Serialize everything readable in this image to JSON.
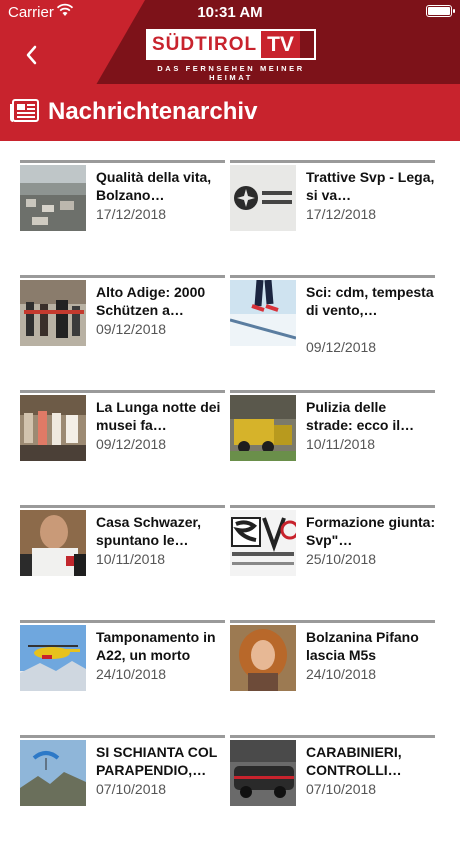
{
  "status_bar": {
    "carrier": "Carrier",
    "time": "10:31 AM"
  },
  "header": {
    "logo_left": "SÜDTIROL",
    "logo_right": "TV",
    "tagline": "DAS FERNSEHEN MEINER HEIMAT"
  },
  "section": {
    "title": "Nachrichtenarchiv"
  },
  "articles": [
    {
      "headline": "Qualità della vita, Bolzano…",
      "date": "17/12/2018"
    },
    {
      "headline": "Trattive Svp - Lega, si va…",
      "date": "17/12/2018"
    },
    {
      "headline": "Alto Adige: 2000 Schützen a…",
      "date": "09/12/2018"
    },
    {
      "headline": "Sci: cdm, tempesta di vento,…",
      "date": "09/12/2018"
    },
    {
      "headline": "La Lunga notte dei musei fa…",
      "date": "09/12/2018"
    },
    {
      "headline": "Pulizia delle strade: ecco il…",
      "date": "10/11/2018"
    },
    {
      "headline": "Casa Schwazer, spuntano le…",
      "date": "10/11/2018"
    },
    {
      "headline": "Formazione giunta: Svp\"…",
      "date": "25/10/2018"
    },
    {
      "headline": "Tamponamento in A22, un morto",
      "date": "24/10/2018"
    },
    {
      "headline": "Bolzanina Pifano lascia M5s",
      "date": "24/10/2018"
    },
    {
      "headline": "SI SCHIANTA COL PARAPENDIO,…",
      "date": "07/10/2018"
    },
    {
      "headline": "CARABINIERI, CONTROLLI…",
      "date": "07/10/2018"
    }
  ],
  "colors": {
    "brand_red": "#c8232d",
    "header_dark": "#7d1219"
  }
}
